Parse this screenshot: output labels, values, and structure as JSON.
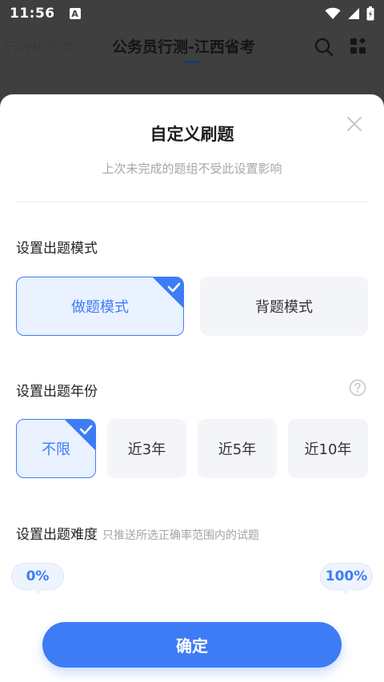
{
  "status": {
    "time": "11:56",
    "a_icon_label": "A",
    "icons": [
      "wifi-icon",
      "signal-icon",
      "battery-icon"
    ]
  },
  "background_header": {
    "tab_left": "行政执法类",
    "tab_active": "公务员行测-江西省考",
    "icons": [
      "search-icon",
      "grid-icon"
    ]
  },
  "sheet": {
    "title": "自定义刷题",
    "subtitle": "上次未完成的题组不受此设置影响",
    "mode_section": {
      "label": "设置出题模式",
      "options": [
        {
          "label": "做题模式",
          "selected": true
        },
        {
          "label": "背题模式",
          "selected": false
        }
      ]
    },
    "year_section": {
      "label": "设置出题年份",
      "options": [
        {
          "label": "不限",
          "selected": true
        },
        {
          "label": "近3年",
          "selected": false
        },
        {
          "label": "近5年",
          "selected": false
        },
        {
          "label": "近10年",
          "selected": false
        }
      ]
    },
    "difficulty_section": {
      "label": "设置出题难度",
      "hint": "只推送所选正确率范围内的试题",
      "min_label": "0%",
      "max_label": "100%"
    },
    "confirm_label": "确定"
  },
  "colors": {
    "accent": "#3d7cf5",
    "selected_bg": "#eaf2ff",
    "option_bg": "#f3f5f9",
    "overlay": "#3f3f3f"
  }
}
